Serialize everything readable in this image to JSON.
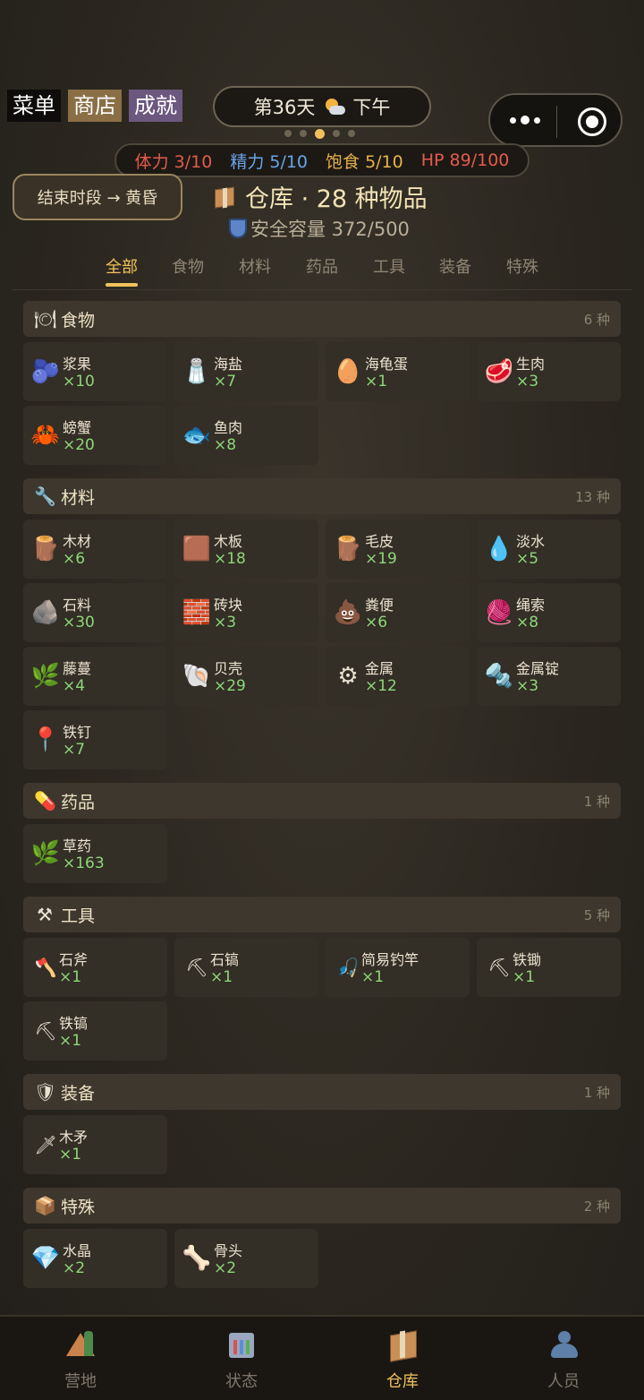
{
  "top_menu": {
    "menu": "菜单",
    "shop": "商店",
    "achievements": "成就"
  },
  "day": {
    "label": "第36天",
    "period": "下午",
    "weather_icon": "sun-cloud-icon"
  },
  "page_dots": {
    "count": 5,
    "active_index": 2
  },
  "stats": {
    "stamina": "体力 3/10",
    "energy": "精力 5/10",
    "hunger": "饱食 5/10",
    "hp": "HP 89/100"
  },
  "end_period_button": "结束时段 → 黄昏",
  "warehouse": {
    "title": "仓库 · 28 种物品",
    "capacity": "安全容量 372/500"
  },
  "tabs": [
    "全部",
    "食物",
    "材料",
    "药品",
    "工具",
    "装备",
    "特殊"
  ],
  "active_tab": 0,
  "sections": {
    "food": {
      "title": "食物",
      "count": "6 种",
      "icon": "plate-icon",
      "items": [
        {
          "name": "浆果",
          "qty": "×10",
          "icon": "🫐"
        },
        {
          "name": "海盐",
          "qty": "×7",
          "icon": "🧂"
        },
        {
          "name": "海龟蛋",
          "qty": "×1",
          "icon": "🥚"
        },
        {
          "name": "生肉",
          "qty": "×3",
          "icon": "🥩"
        },
        {
          "name": "螃蟹",
          "qty": "×20",
          "icon": "🦀"
        },
        {
          "name": "鱼肉",
          "qty": "×8",
          "icon": "🐟"
        }
      ]
    },
    "materials": {
      "title": "材料",
      "count": "13 种",
      "icon": "wrench-icon",
      "items": [
        {
          "name": "木材",
          "qty": "×6",
          "icon": "🪵"
        },
        {
          "name": "木板",
          "qty": "×18",
          "icon": "🟫"
        },
        {
          "name": "毛皮",
          "qty": "×19",
          "icon": "🪵"
        },
        {
          "name": "淡水",
          "qty": "×5",
          "icon": "💧"
        },
        {
          "name": "石料",
          "qty": "×30",
          "icon": "🪨"
        },
        {
          "name": "砖块",
          "qty": "×3",
          "icon": "🧱"
        },
        {
          "name": "粪便",
          "qty": "×6",
          "icon": "💩"
        },
        {
          "name": "绳索",
          "qty": "×8",
          "icon": "🧶"
        },
        {
          "name": "藤蔓",
          "qty": "×4",
          "icon": "🌿"
        },
        {
          "name": "贝壳",
          "qty": "×29",
          "icon": "🐚"
        },
        {
          "name": "金属",
          "qty": "×12",
          "icon": "⚙"
        },
        {
          "name": "金属锭",
          "qty": "×3",
          "icon": "🔩"
        },
        {
          "name": "铁钉",
          "qty": "×7",
          "icon": "📍"
        }
      ]
    },
    "medicine": {
      "title": "药品",
      "count": "1 种",
      "icon": "pill-icon",
      "items": [
        {
          "name": "草药",
          "qty": "×163",
          "icon": "🌿"
        }
      ]
    },
    "tools": {
      "title": "工具",
      "count": "5 种",
      "icon": "tools-icon",
      "items": [
        {
          "name": "石斧",
          "qty": "×1",
          "icon": "🪓"
        },
        {
          "name": "石镐",
          "qty": "×1",
          "icon": "⛏"
        },
        {
          "name": "简易钓竿",
          "qty": "×1",
          "icon": "🎣"
        },
        {
          "name": "铁锄",
          "qty": "×1",
          "icon": "⛏"
        },
        {
          "name": "铁镐",
          "qty": "×1",
          "icon": "⛏"
        }
      ]
    },
    "equipment": {
      "title": "装备",
      "count": "1 种",
      "icon": "shield-icon",
      "items": [
        {
          "name": "木矛",
          "qty": "×1",
          "icon": "🗡"
        }
      ]
    },
    "special": {
      "title": "特殊",
      "count": "2 种",
      "icon": "box-icon",
      "items": [
        {
          "name": "水晶",
          "qty": "×2",
          "icon": "💎"
        },
        {
          "name": "骨头",
          "qty": "×2",
          "icon": "🦴"
        }
      ]
    }
  },
  "bottom_nav": [
    {
      "label": "营地",
      "icon": "tent-icon"
    },
    {
      "label": "状态",
      "icon": "chart-icon"
    },
    {
      "label": "仓库",
      "icon": "box-icon"
    },
    {
      "label": "人员",
      "icon": "people-icon"
    }
  ],
  "bottom_nav_active": 2,
  "colors": {
    "accent": "#f1c25a",
    "qty_green": "#8ed67a",
    "stamina": "#e25b4b",
    "energy": "#6aa3e6",
    "hunger": "#e7b24b"
  }
}
